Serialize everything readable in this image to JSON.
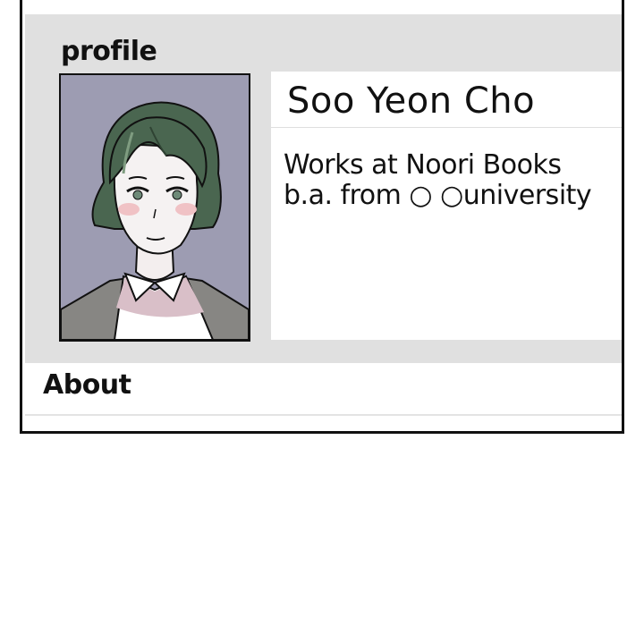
{
  "profile": {
    "title": "profile",
    "name": "Soo Yeon Cho",
    "details": [
      "Works at Noori Books",
      "b.a. from ○ ○university"
    ],
    "photo": {
      "icon": "profile-photo",
      "background_color": "#9d9cb2",
      "hair_color": "#4a6650",
      "jacket_color": "#878683"
    }
  },
  "about": {
    "label": "About"
  },
  "colors": {
    "panel_background": "#e0e0e0",
    "card_background": "#ffffff",
    "border": "#111111"
  }
}
